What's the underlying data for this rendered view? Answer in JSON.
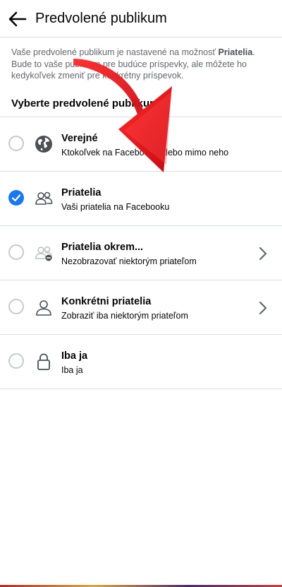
{
  "header": {
    "title": "Predvolené publikum"
  },
  "intro": {
    "text_before": "Vaše predvolené publikum je nastavené na možnosť ",
    "highlight": "Priatelia",
    "text_after": ". Bude to vaše publikum pre budúce príspevky, ale môžete ho kedykoľvek zmeniť pre konkrétny príspevok."
  },
  "section_title": "Vyberte predvolené publikum",
  "options": [
    {
      "label": "Verejné",
      "description": "Ktokoľvek na Facebooku alebo mimo neho",
      "icon": "globe-icon",
      "checked": false,
      "has_chevron": false
    },
    {
      "label": "Priatelia",
      "description": "Vaši priatelia na Facebooku",
      "icon": "friends-icon",
      "checked": true,
      "has_chevron": false
    },
    {
      "label": "Priatelia okrem...",
      "description": "Nezobrazovať niektorým priateľom",
      "icon": "friends-except-icon",
      "checked": false,
      "has_chevron": true
    },
    {
      "label": "Konkrétni priatelia",
      "description": "Zobraziť iba niektorým priateľom",
      "icon": "specific-friend-icon",
      "checked": false,
      "has_chevron": true
    },
    {
      "label": "Iba ja",
      "description": "Iba ja",
      "icon": "lock-icon",
      "checked": false,
      "has_chevron": false
    }
  ],
  "colors": {
    "accent": "#1877f2",
    "arrow": "#e0141e",
    "text": "#050505",
    "secondary": "#65676b"
  }
}
